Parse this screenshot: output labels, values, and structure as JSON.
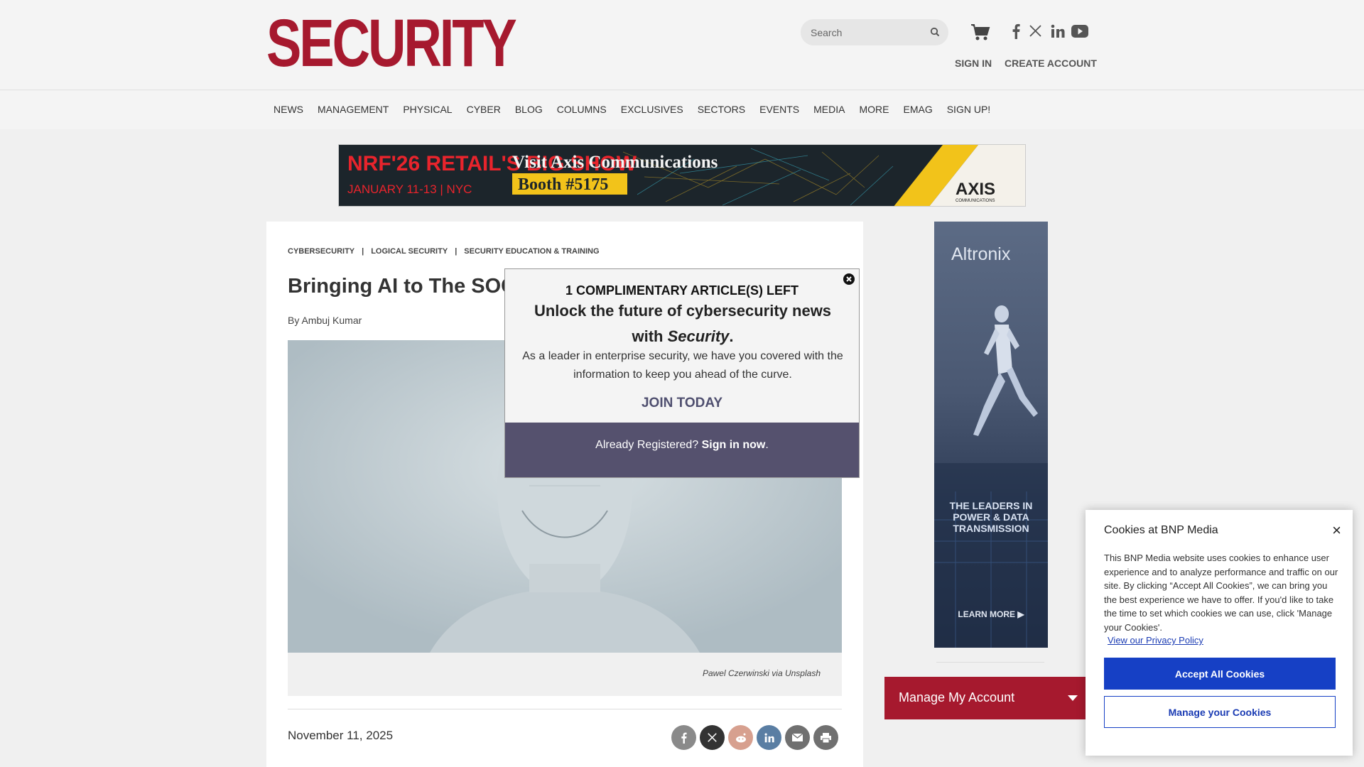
{
  "header": {
    "logo_text": "SECURITY",
    "search_placeholder": "Search",
    "sign_in": "SIGN IN",
    "create_account": "CREATE ACCOUNT",
    "social_icons": [
      "facebook-icon",
      "x-icon",
      "linkedin-icon",
      "youtube-icon"
    ]
  },
  "nav": {
    "items": [
      "NEWS",
      "MANAGEMENT",
      "PHYSICAL",
      "CYBER",
      "BLOG",
      "COLUMNS",
      "EXCLUSIVES",
      "SECTORS",
      "EVENTS",
      "MEDIA",
      "MORE",
      "EMAG",
      "SIGN UP!"
    ]
  },
  "banner_ad": {
    "event": "NRF'26 RETAIL'S BIG SHOW",
    "dates": "JANUARY 11-13 | NYC",
    "headline": "Visit Axis Communications",
    "booth": "Booth #5175",
    "brand": "AXIS",
    "brand_sub": "COMMUNICATIONS"
  },
  "article": {
    "breadcrumbs": [
      "CYBERSECURITY",
      "LOGICAL SECURITY",
      "SECURITY EDUCATION & TRAINING"
    ],
    "title": "Bringing AI to The SOC",
    "byline": "By Ambuj Kumar",
    "caption": "Pawel Czerwinski via Unsplash",
    "date": "November 11, 2025",
    "share_icons": [
      "facebook-icon",
      "x-icon",
      "reddit-icon",
      "linkedin-icon",
      "email-icon",
      "print-icon"
    ]
  },
  "side_ad": {
    "brand": "Altronix",
    "tagline": "THE LEADERS IN POWER & DATA TRANSMISSION",
    "cta": "LEARN MORE ▶"
  },
  "manage_account": {
    "label": "Manage My Account"
  },
  "paywall": {
    "count": "1 COMPLIMENTARY ARTICLE(S) LEFT",
    "headline_main": "Unlock the future of cybersecurity news with ",
    "headline_emph": "Security",
    "headline_end": ".",
    "body": "As a leader in enterprise security, we have you covered with the information to keep you ahead of the curve.",
    "join": "JOIN TODAY",
    "footer_prefix": "Already Registered? ",
    "footer_link": "Sign in now",
    "footer_suffix": "."
  },
  "cookie": {
    "title": "Cookies at BNP Media",
    "close": "×",
    "body": "This BNP Media website uses cookies to enhance user experience and to analyze performance and traffic on our site. By clicking “Accept All Cookies”, we can bring you the best experience we have to offer. If you'd like to take the time to set which cookies we can use, click 'Manage your Cookies'.",
    "policy_link": "View our Privacy Policy",
    "accept": "Accept All Cookies",
    "manage": "Manage your Cookies"
  },
  "colors": {
    "brand_red": "#a6192e",
    "paywall_footer": "#55516e",
    "cookie_blue": "#1640c5"
  }
}
